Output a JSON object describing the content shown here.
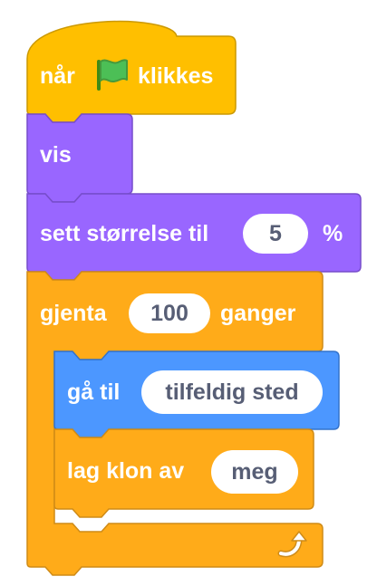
{
  "script": {
    "hat": {
      "prefix": "når",
      "suffix": "klikkes",
      "flag_icon": "green-flag-icon"
    },
    "show": {
      "label": "vis"
    },
    "set_size": {
      "label": "sett størrelse til",
      "value": "5",
      "unit": "%"
    },
    "repeat": {
      "label": "gjenta",
      "count": "100",
      "suffix": "ganger",
      "loop_icon": "loop-arrow-icon"
    },
    "goto": {
      "label": "gå til",
      "target": "tilfeldig sted"
    },
    "clone": {
      "label": "lag klon av",
      "target": "meg"
    }
  },
  "colors": {
    "events": "#ffbf00",
    "events_edge": "#cc9900",
    "looks": "#9966ff",
    "looks_edge": "#774dcb",
    "control": "#ffab19",
    "control_edge": "#cf8b17",
    "motion": "#4c97ff",
    "motion_edge": "#3373cc",
    "text_on_block": "#ffffff",
    "input_text": "#575e75"
  }
}
